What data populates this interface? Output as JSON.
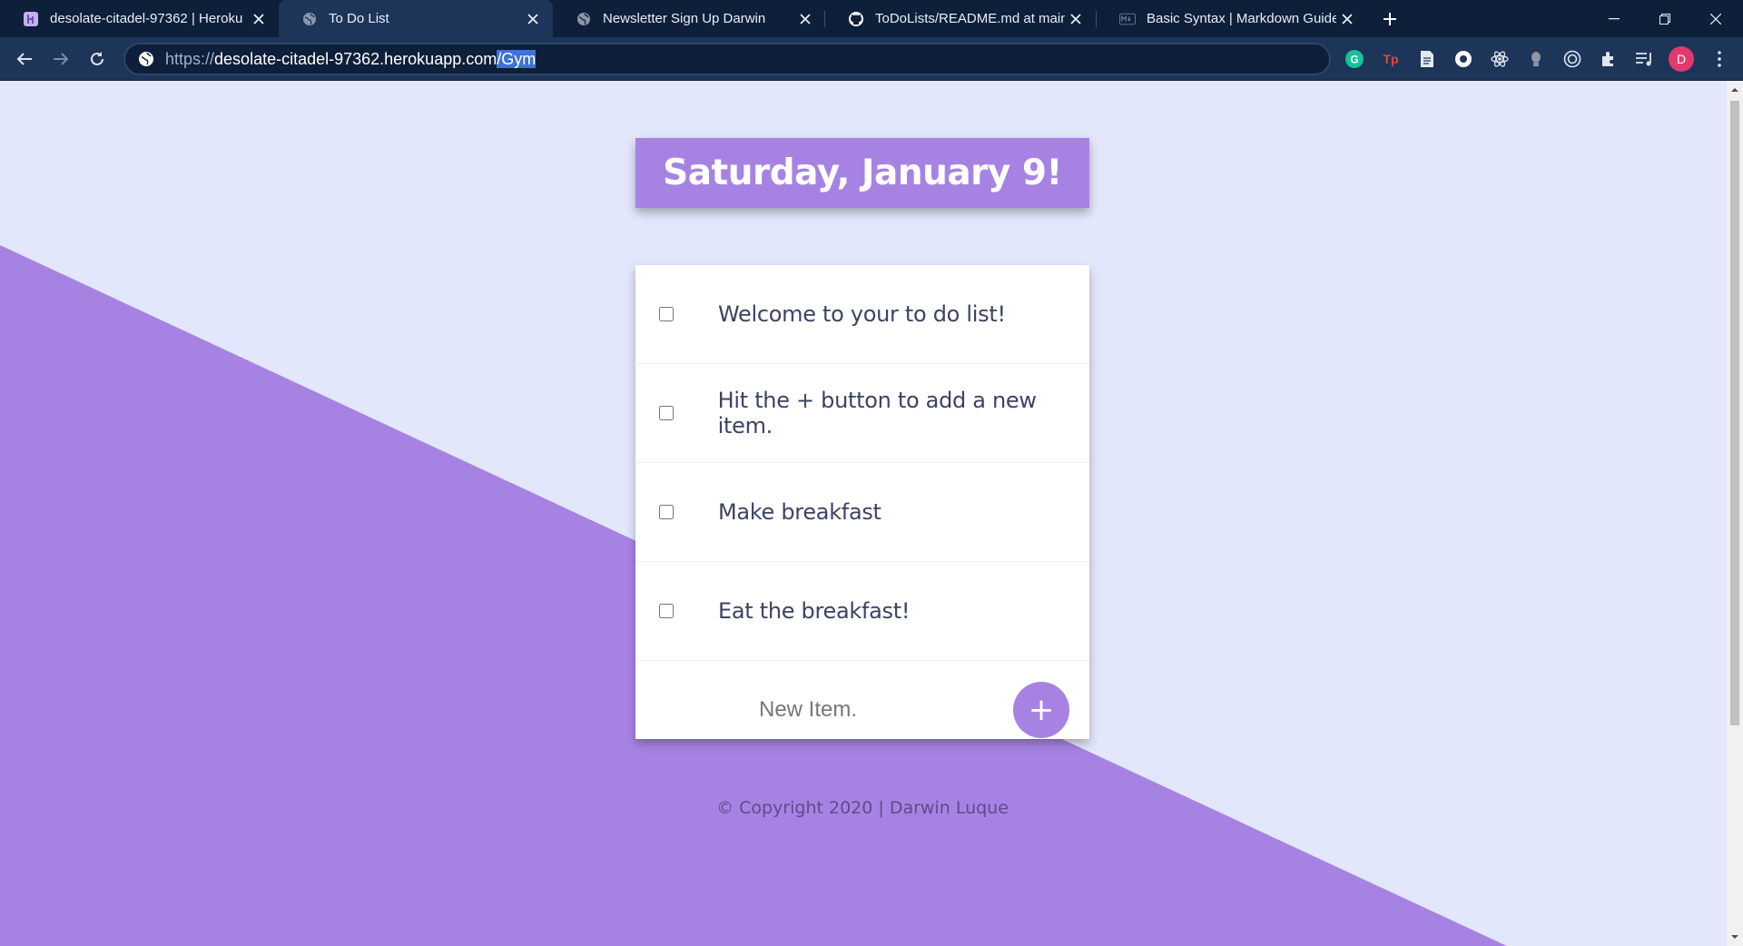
{
  "browser": {
    "tabs": [
      {
        "title": "desolate-citadel-97362 | Heroku",
        "favicon": "heroku-icon",
        "active": false
      },
      {
        "title": "To Do List",
        "favicon": "globe-icon",
        "active": true
      },
      {
        "title": "Newsletter Sign Up Darwin",
        "favicon": "globe-icon",
        "active": false
      },
      {
        "title": "ToDoLists/README.md at main · ",
        "favicon": "github-icon",
        "active": false
      },
      {
        "title": "Basic Syntax | Markdown Guide",
        "favicon": "markdown-icon",
        "active": false
      }
    ],
    "url": {
      "scheme": "https://",
      "host": "desolate-citadel-97362.herokuapp.com",
      "path_selected": "/Gym"
    },
    "profile_initial": "D",
    "extensions": [
      "grammarly-icon",
      "tp-icon",
      "document-icon",
      "circle-extension-icon",
      "react-icon",
      "lamp-icon",
      "target-icon",
      "puzzle-icon",
      "media-icon"
    ]
  },
  "page": {
    "heading": "Saturday, January 9!",
    "items": [
      {
        "text": "Welcome to your to do list!",
        "checked": false
      },
      {
        "text": "Hit the + button to add a new item.",
        "checked": false
      },
      {
        "text": "Make breakfast",
        "checked": false
      },
      {
        "text": "Eat the breakfast!",
        "checked": false
      }
    ],
    "new_item_placeholder": "New Item.",
    "add_button_label": "+",
    "footer": "© Copyright 2020 | Darwin Luque"
  },
  "colors": {
    "accent": "#a683e3",
    "background": "#e3e7fb",
    "browser_frame": "#0e1f3a",
    "browser_toolbar": "#1d3559"
  }
}
